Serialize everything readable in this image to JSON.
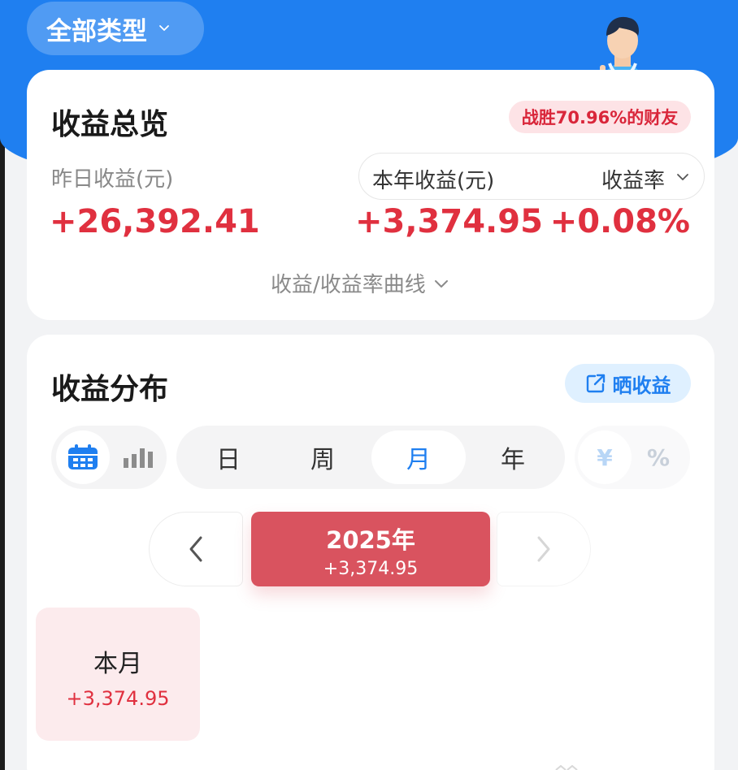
{
  "header": {
    "type_selector": "全部类型"
  },
  "overview": {
    "title": "收益总览",
    "beat_badge": "战胜70.96%的财友",
    "yesterday_label": "昨日收益(元)",
    "yesterday_value": "+26,392.41",
    "year_label": "本年收益(元)",
    "rate_label": "收益率",
    "year_value": "+3,374.95",
    "rate_value": "+0.08%",
    "curve_toggle": "收益/收益率曲线"
  },
  "distribution": {
    "title": "收益分布",
    "share_button": "晒收益",
    "view_modes": [
      "calendar-icon",
      "bar-chart-icon"
    ],
    "active_view": "calendar",
    "period_tabs": [
      "日",
      "周",
      "月",
      "年"
    ],
    "active_period": "月",
    "unit_options": [
      "¥",
      "%"
    ],
    "active_unit": "¥",
    "year_chip": {
      "year": "2025年",
      "amount": "+3,374.95"
    },
    "months": [
      {
        "label": "本月",
        "amount": "+3,374.95"
      }
    ]
  },
  "colors": {
    "brand_blue": "#1f7ff0",
    "profit_red": "#e0303f",
    "chip_red": "#d9535f",
    "badge_pink": "#fde3e6"
  }
}
